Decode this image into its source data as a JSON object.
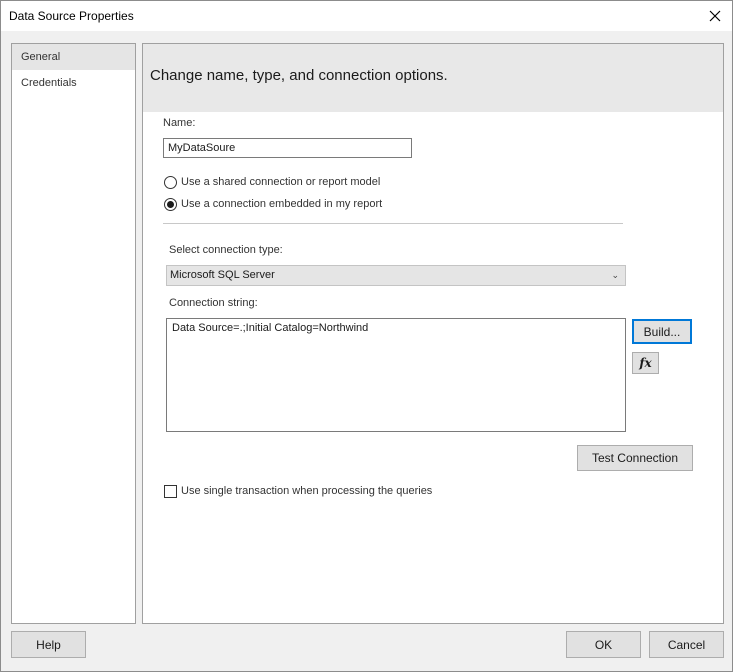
{
  "window": {
    "title": "Data Source Properties"
  },
  "sidebar": {
    "items": [
      {
        "label": "General"
      },
      {
        "label": "Credentials"
      }
    ]
  },
  "panel": {
    "heading": "Change name, type, and connection options.",
    "name_label": "Name:",
    "name_value": "MyDataSoure",
    "radio_shared_label": "Use a shared connection or report model",
    "radio_embedded_label": "Use a connection embedded in my report",
    "radio_selected": "embedded",
    "conn_type_label": "Select connection type:",
    "conn_type_value": "Microsoft SQL Server",
    "conn_string_label": "Connection string:",
    "conn_string_value": "Data Source=.;Initial Catalog=Northwind",
    "build_button": "Build...",
    "fx_button": "fx",
    "test_button": "Test Connection",
    "single_txn_label": "Use single transaction when processing the queries",
    "single_txn_checked": false
  },
  "footer": {
    "help_button": "Help",
    "ok_button": "OK",
    "cancel_button": "Cancel"
  }
}
